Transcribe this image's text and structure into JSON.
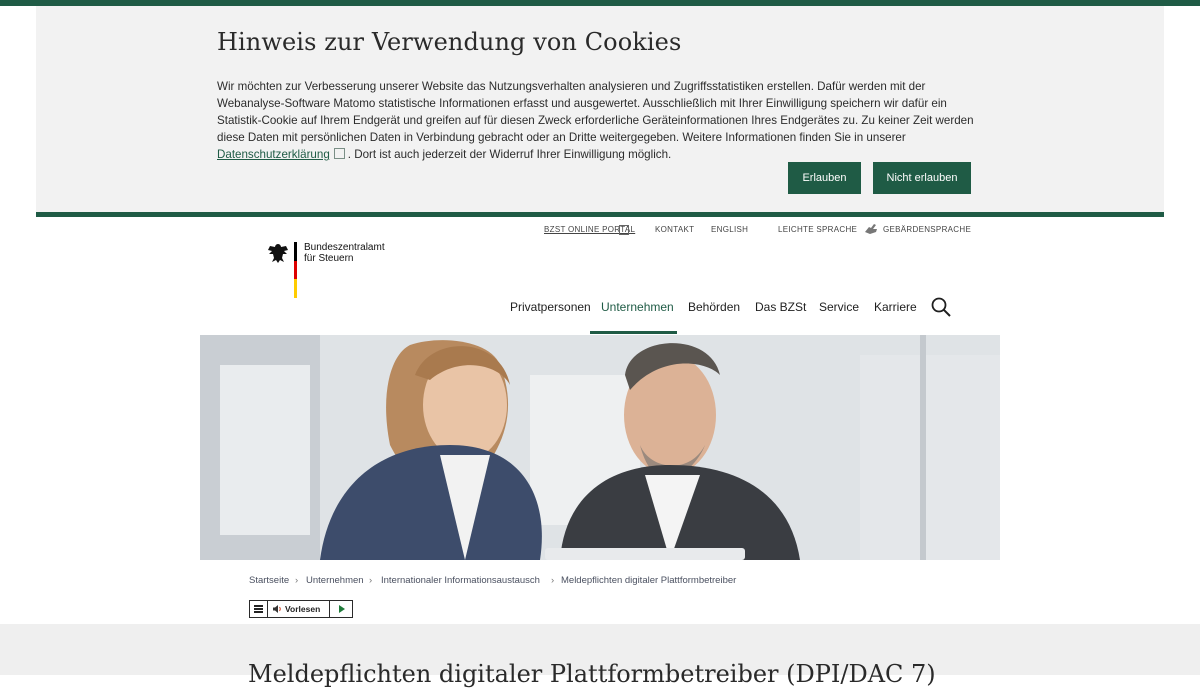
{
  "cookie_banner": {
    "title": "Hinweis zur Verwendung von Cookies",
    "text_before_link": "Wir möchten zur Verbesserung unserer Website das Nutzungsverhalten analysieren und Zugriffsstatistiken erstellen. Dafür werden mit der Webanalyse-Software Matomo statistische Informationen erfasst und ausgewertet. Ausschließlich mit Ihrer Einwilligung speichern wir dafür ein Statistik-Cookie auf Ihrem Endgerät und greifen auf für diesen Zweck erforderliche Geräteinformationen Ihres Endgerätes zu. Zu keiner Zeit werden diese Daten mit persönlichen Daten in Verbindung gebracht oder an Dritte weitergegeben. Weitere Informationen finden Sie in unserer",
    "link_label": "Datenschutzerklärung",
    "text_after_link": ". Dort ist auch jederzeit der Widerruf Ihrer Einwilligung möglich.",
    "allow_label": "Erlauben",
    "deny_label": "Nicht erlauben"
  },
  "utility_nav": {
    "portal": "BZST ONLINE PORTAL",
    "kontakt": "KONTAKT",
    "english": "ENGLISH",
    "leichte_sprache": "LEICHTE SPRACHE",
    "gebaerdensprache": "GEBÄRDENSPRACHE"
  },
  "logo": {
    "line1": "Bundeszentralamt",
    "line2": "für Steuern"
  },
  "main_nav": {
    "privatpersonen": "Privatpersonen",
    "unternehmen": "Unternehmen",
    "behoerden": "Behörden",
    "das_bzst": "Das BZSt",
    "service": "Service",
    "karriere": "Karriere"
  },
  "breadcrumb": [
    "Startseite",
    "Unternehmen",
    "Internationaler Informationsaustausch",
    "Meldepflichten digitaler Plattformbetreiber"
  ],
  "reader": {
    "label": "Vorlesen"
  },
  "page_title": "Meldepflichten digitaler Plattformbetreiber (DPI/DAC 7)",
  "colors": {
    "brand_green": "#1f5b45",
    "banner_bg": "#f2f2f2"
  }
}
